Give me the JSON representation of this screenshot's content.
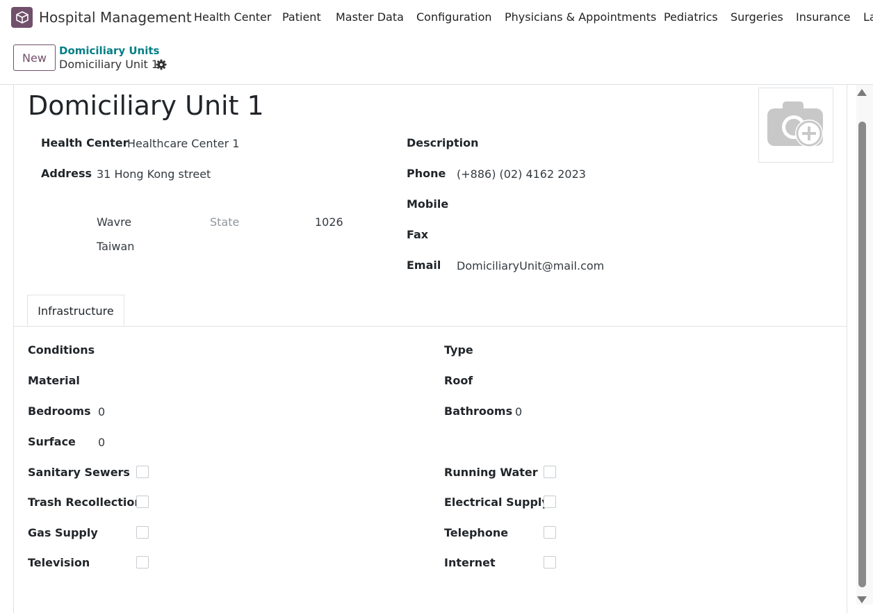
{
  "navbar": {
    "app_name": "Hospital Management",
    "menu": [
      "Health Center",
      "Patient",
      "Master Data",
      "Configuration",
      "Physicians & Appointments",
      "Pediatrics",
      "Surgeries",
      "Insurance",
      "La"
    ]
  },
  "control": {
    "new_label": "New",
    "breadcrumb_parent": "Domiciliary Units",
    "breadcrumb_current": "Domiciliary Unit 1"
  },
  "record": {
    "title": "Domiciliary Unit 1",
    "health_center_label": "Health Center",
    "health_center": "Healthcare Center 1",
    "address_label": "Address",
    "street": "31 Hong Kong street",
    "city": "Wavre",
    "state_placeholder": "State",
    "zip": "1026",
    "country": "Taiwan",
    "description_label": "Description",
    "phone_label": "Phone",
    "phone": "(+886) (02) 4162 2023",
    "mobile_label": "Mobile",
    "fax_label": "Fax",
    "email_label": "Email",
    "email": "DomiciliaryUnit@mail.com"
  },
  "tabs": {
    "infrastructure": "Infrastructure"
  },
  "infrastructure": {
    "conditions_label": "Conditions",
    "type_label": "Type",
    "material_label": "Material",
    "roof_label": "Roof",
    "bedrooms_label": "Bedrooms",
    "bedrooms": "0",
    "bathrooms_label": "Bathrooms",
    "bathrooms": "0",
    "surface_label": "Surface",
    "surface": "0",
    "checkboxes_left": [
      "Sanitary Sewers",
      "Trash Recollection",
      "Gas Supply",
      "Television"
    ],
    "checkboxes_right": [
      "Running Water",
      "Electrical Supply",
      "Telephone",
      "Internet"
    ]
  },
  "colors": {
    "brand": "#71506b",
    "link": "#017e84"
  },
  "icons": {
    "app": "app-cube-icon",
    "settings": "gear-icon",
    "avatar": "camera-add-icon"
  }
}
